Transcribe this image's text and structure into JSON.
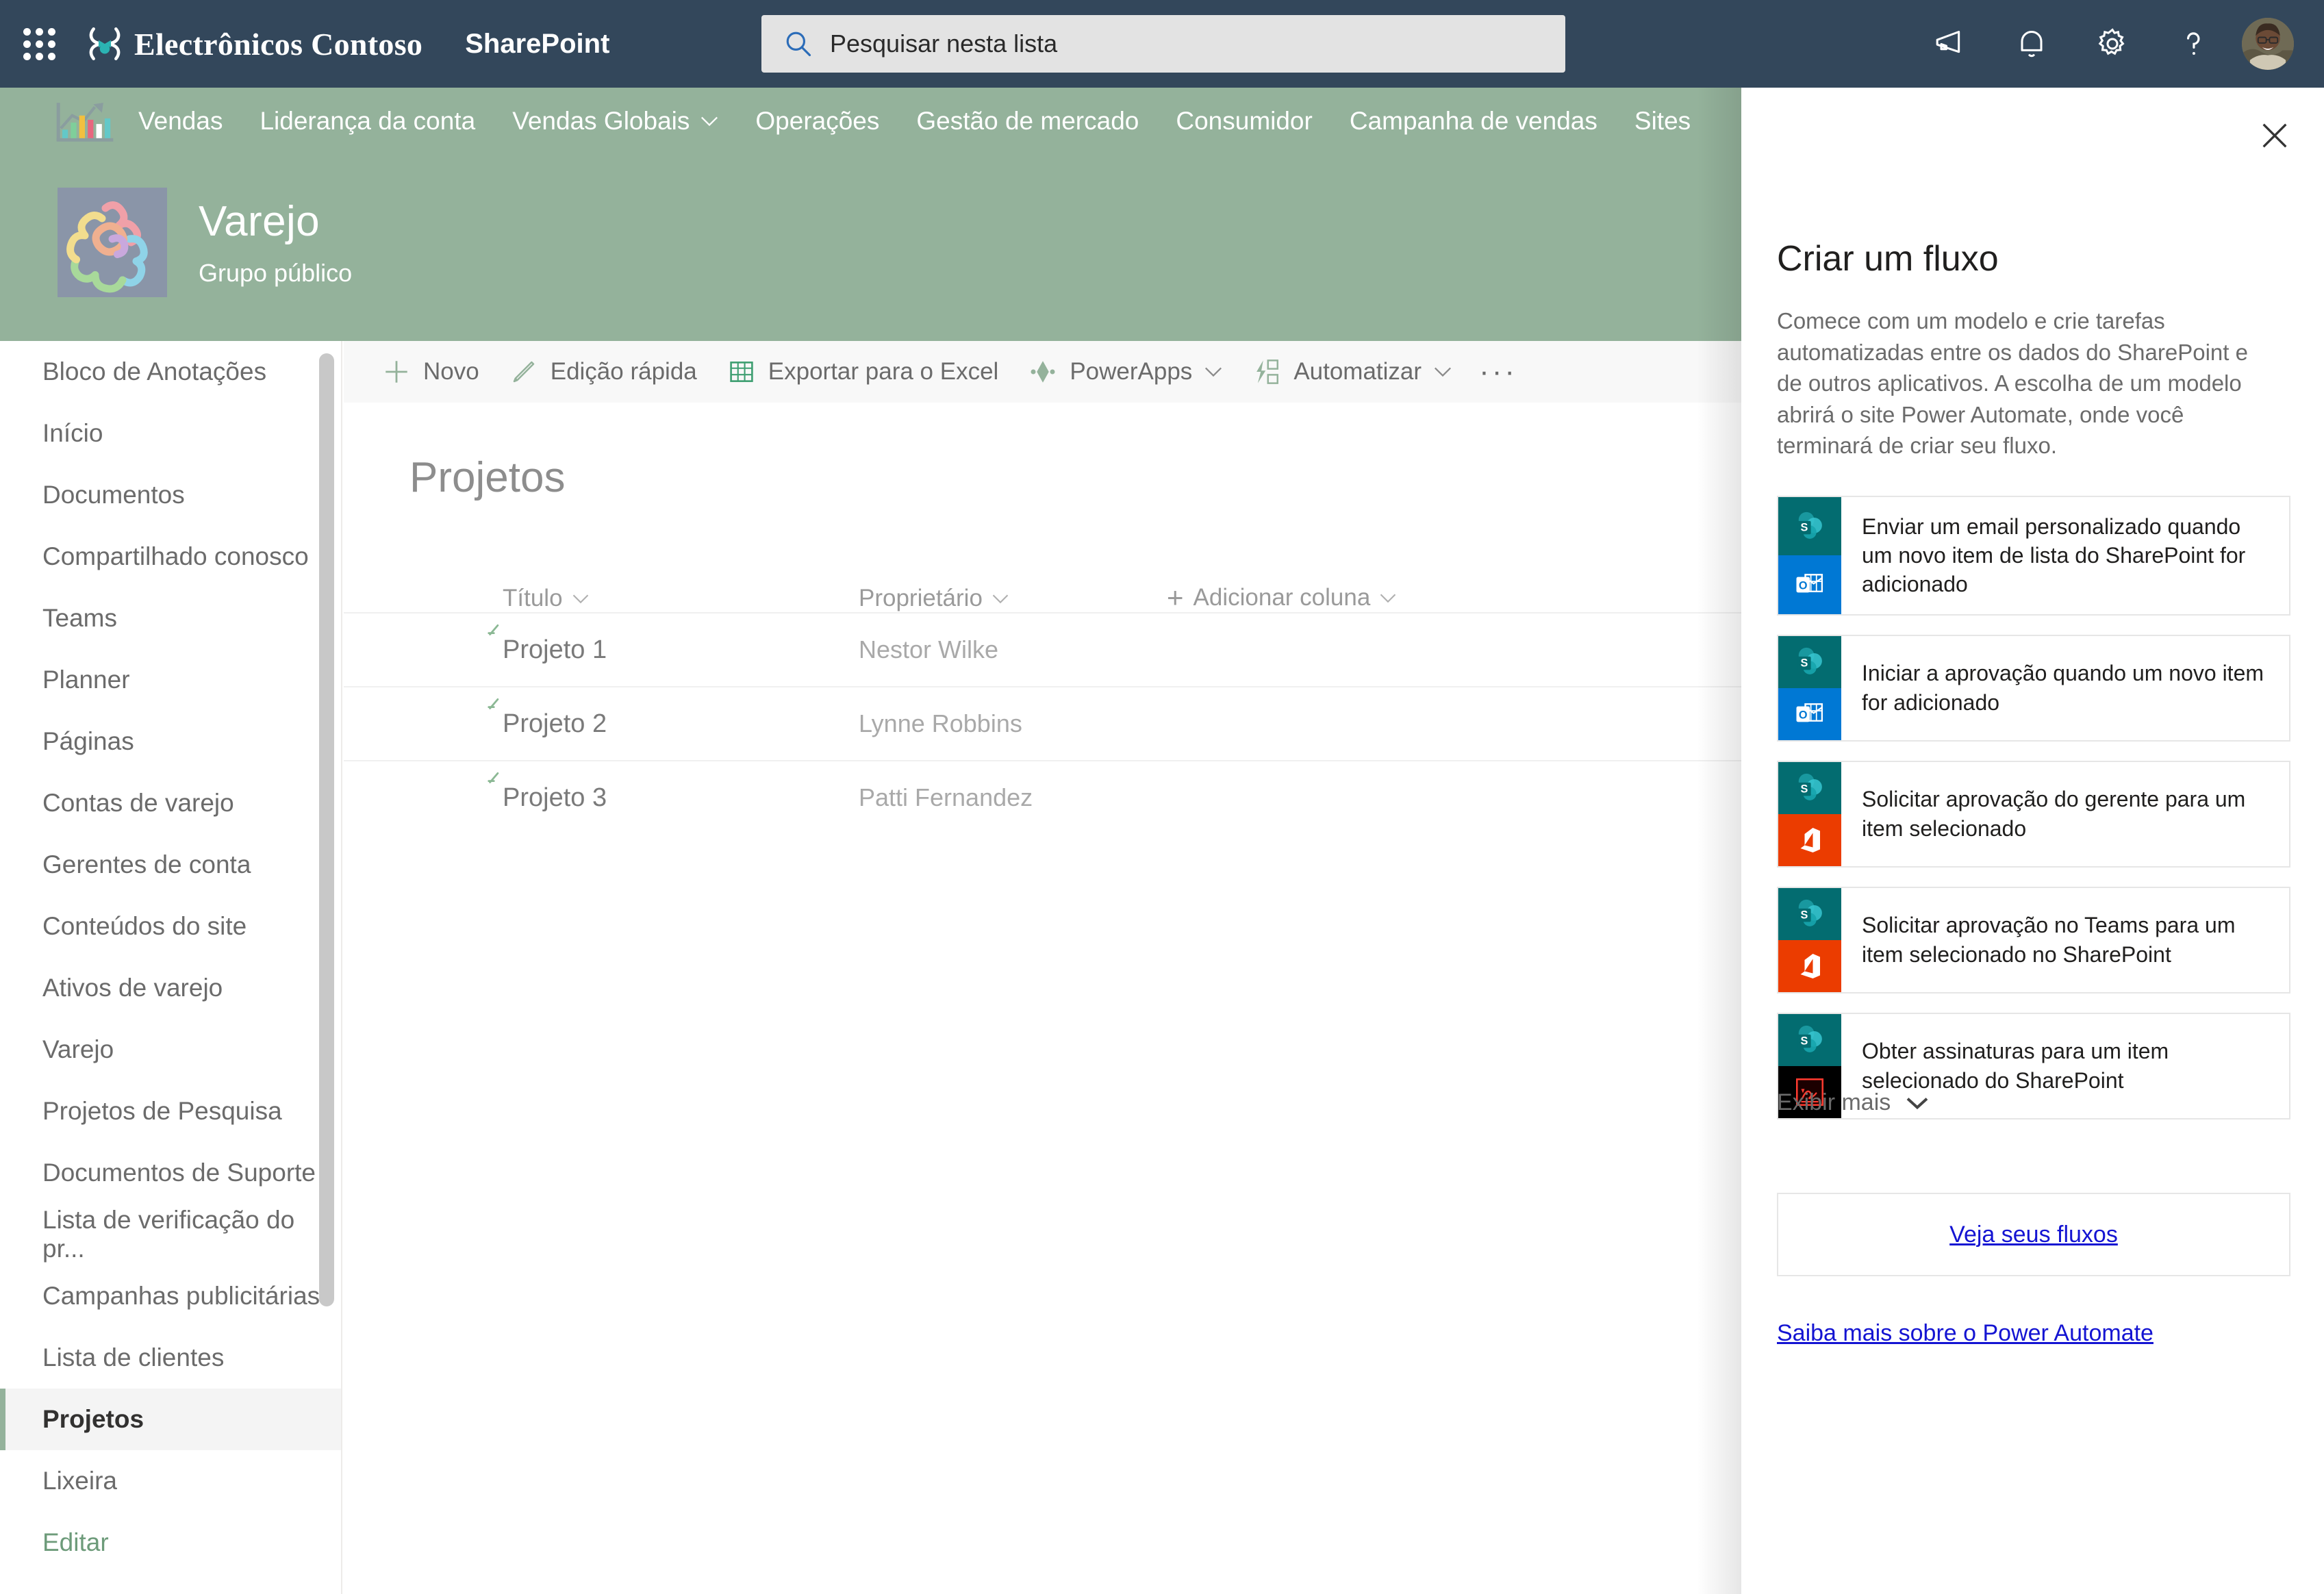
{
  "suite": {
    "waffle_label": "app-launcher",
    "brand": "Electrônicos Contoso",
    "app": "SharePoint",
    "search": {
      "placeholder": "Pesquisar nesta lista",
      "value": ""
    },
    "icons": [
      {
        "name": "megaphone-icon",
        "label": "Novidades"
      },
      {
        "name": "bell-icon",
        "label": "Notificações"
      },
      {
        "name": "gear-icon",
        "label": "Configurações"
      },
      {
        "name": "help-icon",
        "label": "Ajuda"
      }
    ],
    "avatar_label": "Conta de usuário"
  },
  "topnav": {
    "logo_name": "bar-chart-icon",
    "items": [
      {
        "label": "Vendas",
        "has_chevron": false
      },
      {
        "label": "Liderança da conta",
        "has_chevron": false
      },
      {
        "label": "Vendas Globais",
        "has_chevron": true
      },
      {
        "label": "Operações",
        "has_chevron": false
      },
      {
        "label": "Gestão de mercado",
        "has_chevron": false
      },
      {
        "label": "Consumidor",
        "has_chevron": false
      },
      {
        "label": "Campanha de vendas",
        "has_chevron": false
      },
      {
        "label": "Sites",
        "has_chevron": false
      }
    ]
  },
  "site": {
    "title": "Varejo",
    "subtitle": "Grupo público"
  },
  "sidebar": {
    "items": [
      {
        "label": "Bloco de Anotações",
        "selected": false
      },
      {
        "label": "Início",
        "selected": false
      },
      {
        "label": "Documentos",
        "selected": false
      },
      {
        "label": "Compartilhado conosco",
        "selected": false
      },
      {
        "label": "Teams",
        "selected": false
      },
      {
        "label": "Planner",
        "selected": false
      },
      {
        "label": "Páginas",
        "selected": false
      },
      {
        "label": "Contas de varejo",
        "selected": false
      },
      {
        "label": "Gerentes de conta",
        "selected": false
      },
      {
        "label": "Conteúdos do site",
        "selected": false
      },
      {
        "label": "Ativos de varejo",
        "selected": false
      },
      {
        "label": "Varejo",
        "selected": false
      },
      {
        "label": "Projetos de Pesquisa",
        "selected": false
      },
      {
        "label": "Documentos de Suporte",
        "selected": false
      },
      {
        "label": "Lista de verificação do pr...",
        "selected": false
      },
      {
        "label": "Campanhas publicitárias",
        "selected": false
      },
      {
        "label": "Lista de clientes",
        "selected": false
      },
      {
        "label": "Projetos",
        "selected": true
      },
      {
        "label": "Lixeira",
        "selected": false
      },
      {
        "label": "Editar",
        "selected": false,
        "style": "edit"
      }
    ]
  },
  "commandbar": {
    "items": [
      {
        "label": "Novo",
        "icon": "plus-icon",
        "has_chevron": false
      },
      {
        "label": "Edição rápida",
        "icon": "pencil-icon",
        "has_chevron": false
      },
      {
        "label": "Exportar para o Excel",
        "icon": "excel-icon",
        "has_chevron": false
      },
      {
        "label": "PowerApps",
        "icon": "powerapps-icon",
        "has_chevron": true
      },
      {
        "label": "Automatizar",
        "icon": "automate-icon",
        "has_chevron": true
      }
    ],
    "overflow_label": "···"
  },
  "list": {
    "title": "Projetos",
    "columns": [
      {
        "label": "Título",
        "has_chevron": true,
        "has_plus": false
      },
      {
        "label": "Proprietário",
        "has_chevron": true,
        "has_plus": false
      },
      {
        "label": "Adicionar coluna",
        "has_chevron": true,
        "has_plus": true
      }
    ],
    "rows": [
      {
        "title": "Projeto 1",
        "owner": "Nestor Wilke"
      },
      {
        "title": "Projeto 2",
        "owner": "Lynne Robbins"
      },
      {
        "title": "Projeto 3",
        "owner": "Patti Fernandez"
      }
    ]
  },
  "panel": {
    "close_label": "Fechar",
    "title": "Criar um fluxo",
    "description": "Comece com um modelo e crie tarefas automatizadas entre os dados do SharePoint e de outros aplicativos. A escolha de um modelo abrirá o site Power Automate, onde você terminará de criar seu fluxo.",
    "templates": [
      {
        "text": "Enviar um email personalizado quando um novo item de lista do SharePoint for adicionado",
        "icon_top": "sharepoint-icon",
        "icon_bottom": "outlook-icon"
      },
      {
        "text": "Iniciar a aprovação quando um novo item for adicionado",
        "icon_top": "sharepoint-icon",
        "icon_bottom": "outlook-icon"
      },
      {
        "text": "Solicitar aprovação do gerente para um item selecionado",
        "icon_top": "sharepoint-icon",
        "icon_bottom": "office-icon"
      },
      {
        "text": "Solicitar aprovação no Teams para um item selecionado no SharePoint",
        "icon_top": "sharepoint-icon",
        "icon_bottom": "office-icon"
      },
      {
        "text": "Obter assinaturas para um item selecionado do SharePoint",
        "icon_top": "sharepoint-icon",
        "icon_bottom": "adobe-sign-icon"
      }
    ],
    "show_more": "Exibir mais",
    "see_flows": "Veja seus fluxos",
    "learn_more": "Saiba mais sobre o Power Automate"
  },
  "colors": {
    "suitebar": "#33475B",
    "theme_green": "#94b29b",
    "accent_link": "#1414d2",
    "sharepoint_teal": "#036c70",
    "outlook_blue": "#0078d4",
    "office_orange": "#eb3c00",
    "sign_black": "#000000"
  }
}
